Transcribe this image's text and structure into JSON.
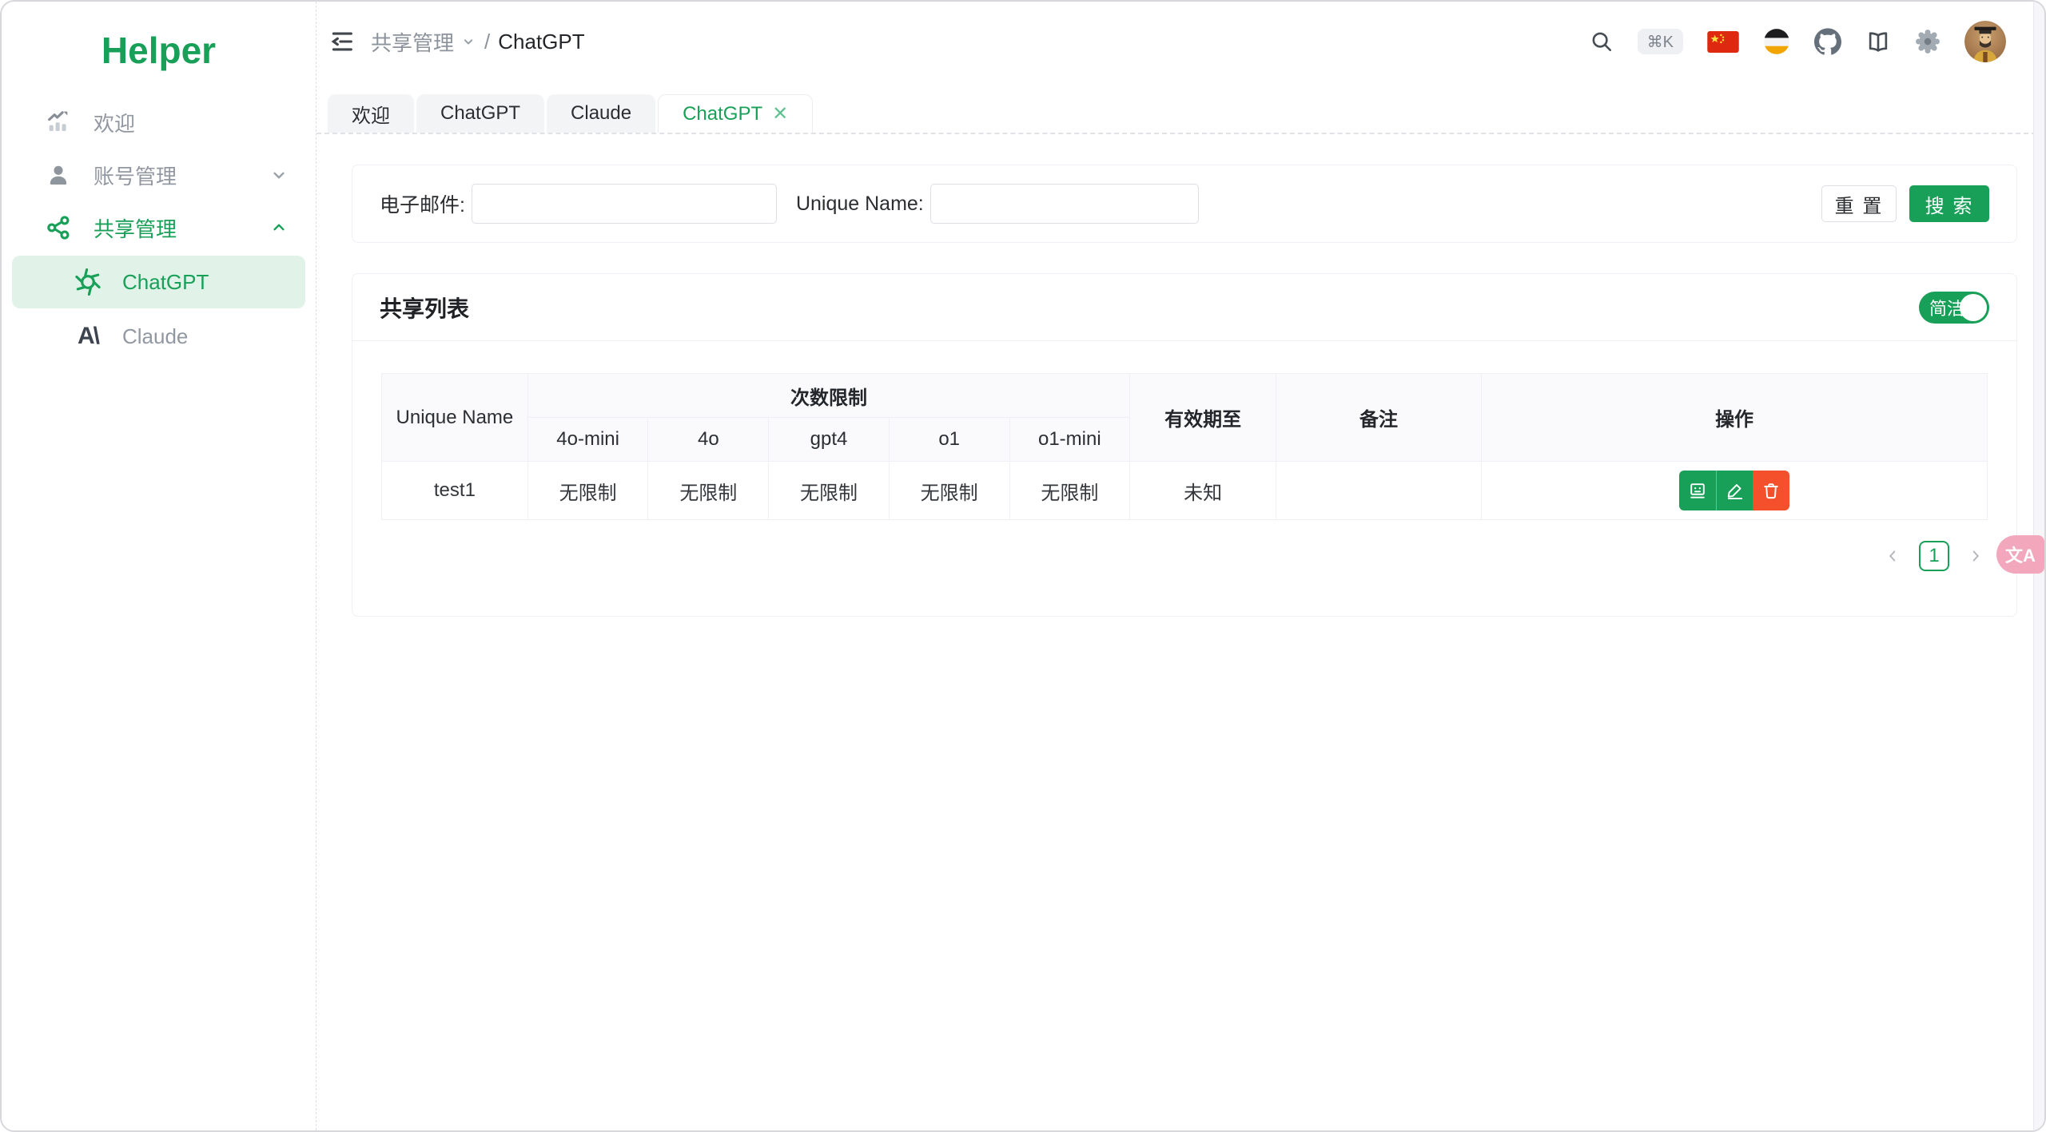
{
  "app": {
    "logo": "Helper"
  },
  "colors": {
    "primary": "#18a058",
    "primary_soft": "#e1f3e8",
    "danger": "#f4502c",
    "pink": "#f2a7bd",
    "flag_red": "#de2910"
  },
  "icons": {
    "close": "✕",
    "translate": "文A",
    "anthropic": "A\\",
    "command_k": "⌘K"
  },
  "sidebar": {
    "items": [
      {
        "label": "欢迎"
      },
      {
        "label": "账号管理"
      },
      {
        "label": "共享管理"
      }
    ],
    "children": [
      {
        "label": "ChatGPT"
      },
      {
        "label": "Claude"
      }
    ]
  },
  "topbar": {
    "breadcrumb": {
      "parent": "共享管理",
      "separator": "/",
      "current": "ChatGPT"
    }
  },
  "tabs": [
    {
      "label": "欢迎"
    },
    {
      "label": "ChatGPT"
    },
    {
      "label": "Claude"
    },
    {
      "label": "ChatGPT"
    }
  ],
  "search_form": {
    "email_label": "电子邮件:",
    "email_value": "",
    "unique_name_label": "Unique Name:",
    "unique_name_value": "",
    "reset_label": "重 置",
    "search_label": "搜 索"
  },
  "share_list": {
    "title": "共享列表",
    "toggle_label": "简洁",
    "table": {
      "header": {
        "unique_name": "Unique Name",
        "limit_group": "次数限制",
        "models": [
          "4o-mini",
          "4o",
          "gpt4",
          "o1",
          "o1-mini"
        ],
        "expire": "有效期至",
        "note": "备注",
        "actions": "操作"
      },
      "rows": [
        {
          "unique_name": "test1",
          "limits": [
            "无限制",
            "无限制",
            "无限制",
            "无限制",
            "无限制"
          ],
          "expire": "未知",
          "note": ""
        }
      ]
    },
    "pagination": {
      "current": "1"
    }
  }
}
